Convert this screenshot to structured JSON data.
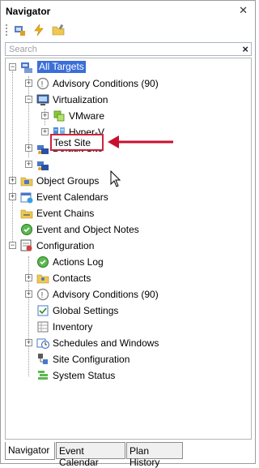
{
  "panel": {
    "title": "Navigator",
    "pin_icon": "pin-close-icon"
  },
  "toolbar": {
    "buttons": [
      "add-target-icon",
      "lightning-icon",
      "folder-edit-icon"
    ]
  },
  "search": {
    "placeholder": "Search",
    "clear": "×"
  },
  "tree": {
    "all_targets": "All Targets",
    "advisory_conditions": "Advisory Conditions (90)",
    "virtualization": "Virtualization",
    "vmware": "VMware",
    "hyperv": "Hyper-V",
    "default_site": "Default Site",
    "test_site": "Test Site",
    "object_groups": "Object Groups",
    "event_calendars": "Event Calendars",
    "event_chains": "Event Chains",
    "event_notes": "Event and Object Notes",
    "configuration": "Configuration",
    "actions_log": "Actions Log",
    "contacts": "Contacts",
    "config_advisory": "Advisory Conditions (90)",
    "global_settings": "Global Settings",
    "inventory": "Inventory",
    "schedules": "Schedules and Windows",
    "site_configuration": "Site Configuration",
    "system_status": "System Status"
  },
  "tabs": [
    "Navigator",
    "Event Calendar",
    "Plan History"
  ],
  "colors": {
    "selection": "#3a6ed8",
    "annotation": "#d0243c"
  }
}
